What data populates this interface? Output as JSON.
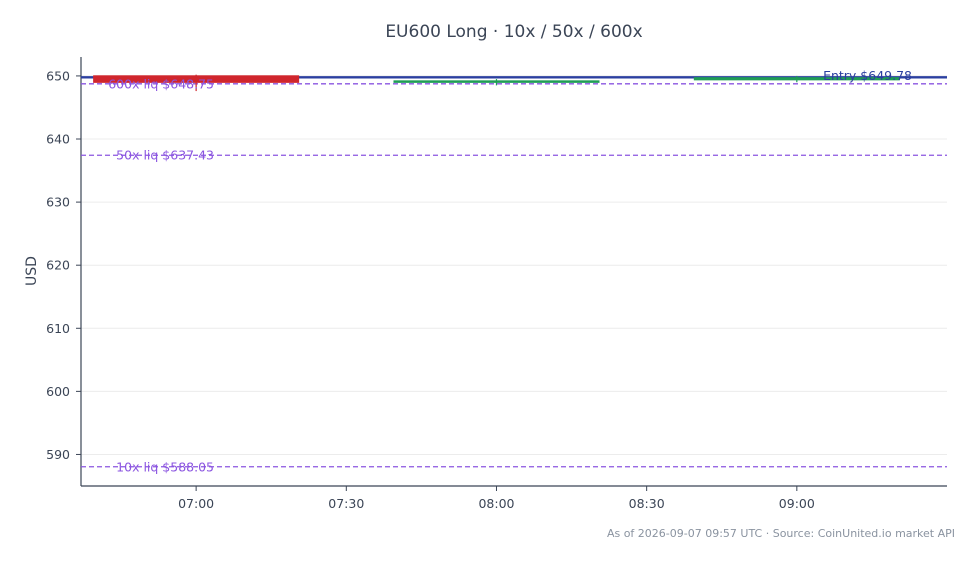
{
  "chart_data": {
    "type": "candlestick",
    "title": "EU600 Long · 10x / 50x / 600x",
    "ylabel": "USD",
    "xlabel": "",
    "ylim": [
      585,
      653
    ],
    "xlim": [
      "06:37",
      "09:30"
    ],
    "y_ticks": [
      590,
      600,
      610,
      620,
      630,
      640,
      650
    ],
    "y_tick_labels": [
      "590",
      "600",
      "610",
      "620",
      "630",
      "640",
      "650"
    ],
    "x_ticks": [
      "07:00",
      "07:30",
      "08:00",
      "08:30",
      "09:00"
    ],
    "x_tick_labels": [
      "07:00",
      "07:30",
      "08:00",
      "08:30",
      "09:00"
    ],
    "grid": true,
    "candles": [
      {
        "time": "07:00",
        "open": 650.1,
        "high": 650.2,
        "low": 647.6,
        "close": 648.9,
        "direction": "down"
      },
      {
        "time": "08:00",
        "open": 648.9,
        "high": 649.5,
        "low": 648.5,
        "close": 649.3,
        "direction": "up"
      },
      {
        "time": "09:00",
        "open": 649.3,
        "high": 650.0,
        "low": 649.0,
        "close": 649.8,
        "direction": "up"
      }
    ],
    "reference_lines": [
      {
        "name": "entry",
        "value": 649.78,
        "label": "Entry $649.78",
        "color": "#2b3fa0",
        "style": "solid",
        "label_align": "right"
      },
      {
        "name": "liq-600x",
        "value": 648.75,
        "label": "600x liq $648.75",
        "color": "#8b55e0",
        "style": "dashed",
        "label_align": "left"
      },
      {
        "name": "liq-50x",
        "value": 637.43,
        "label": "50x liq $637.43",
        "color": "#8b55e0",
        "style": "dashed",
        "label_align": "left"
      },
      {
        "name": "liq-10x",
        "value": 588.05,
        "label": "10x liq $588.05",
        "color": "#8b55e0",
        "style": "dashed",
        "label_align": "left"
      }
    ],
    "colors": {
      "up": "#1f9d55",
      "down": "#d0262d",
      "text": "#3b4556",
      "grid": "#ececec",
      "axis": "#3b4556"
    }
  },
  "footer": {
    "source_note": "As of 2026-09-07 09:57 UTC · Source: CoinUnited.io market API"
  }
}
